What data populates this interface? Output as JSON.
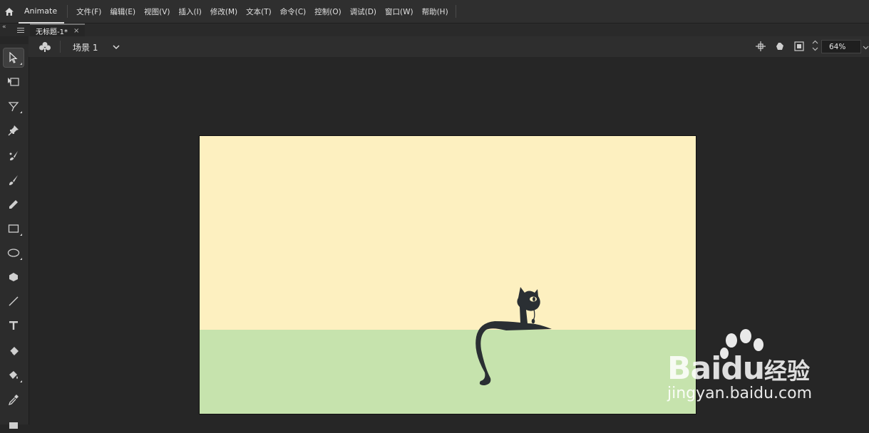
{
  "app": {
    "name": "Animate"
  },
  "menu": [
    "文件(F)",
    "编辑(E)",
    "视图(V)",
    "插入(I)",
    "修改(M)",
    "文本(T)",
    "命令(C)",
    "控制(O)",
    "调试(D)",
    "窗口(W)",
    "帮助(H)"
  ],
  "document_tab": {
    "title": "无标题-1*",
    "close": "×"
  },
  "tab_row": {
    "collapse_glyph": "«"
  },
  "scene": {
    "label": "场景 1"
  },
  "zoom": {
    "value": "64%"
  },
  "tools": [
    "selection-tool-icon",
    "free-transform-tool-icon",
    "lasso-tool-icon",
    "pin-tool-icon",
    "fluid-brush-tool-icon",
    "brush-tool-icon",
    "pencil-tool-icon",
    "rectangle-tool-icon",
    "oval-tool-icon",
    "polystar-tool-icon",
    "line-tool-icon",
    "text-tool-icon",
    "eraser-tool-icon",
    "paint-bucket-tool-icon",
    "eyedropper-tool-icon"
  ],
  "colors": {
    "stage_sky": "#fdf0c0",
    "stage_grass": "#c6e3ad",
    "cat": "#2a2f33",
    "ui_background": "#262626"
  },
  "watermark": {
    "logo": "Bai",
    "logo_suffix": "du",
    "chinese": "经验",
    "url": "jingyan.baidu.com"
  }
}
